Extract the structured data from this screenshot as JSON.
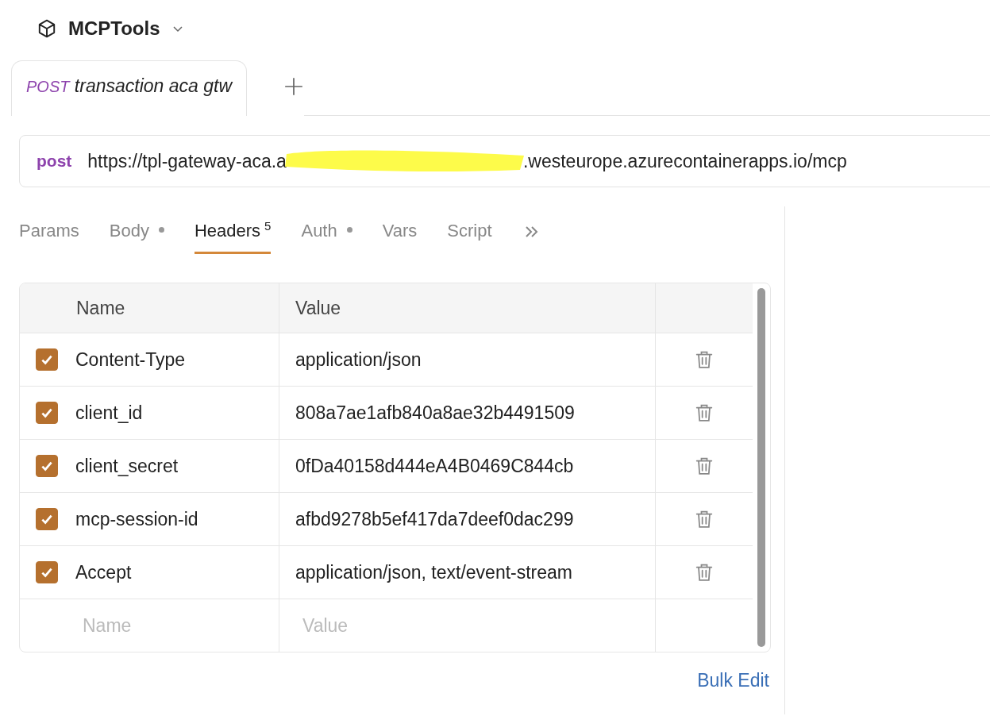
{
  "collection": {
    "name": "MCPTools"
  },
  "request_tabs": [
    {
      "method": "POST",
      "name": "transaction aca gtw",
      "selected": true
    }
  ],
  "url_bar": {
    "method": "post",
    "url_start": "https://tpl-gateway-aca.a",
    "url_end": ".westeurope.azurecontainerapps.io/mcp"
  },
  "section_tabs": [
    {
      "label": "Params",
      "selected": false,
      "indicator": false
    },
    {
      "label": "Body",
      "selected": false,
      "indicator": true
    },
    {
      "label": "Headers",
      "selected": true,
      "indicator": false,
      "count": "5"
    },
    {
      "label": "Auth",
      "selected": false,
      "indicator": true
    },
    {
      "label": "Vars",
      "selected": false,
      "indicator": false
    },
    {
      "label": "Script",
      "selected": false,
      "indicator": false
    }
  ],
  "headers_table": {
    "columns": [
      "Name",
      "Value"
    ],
    "rows": [
      {
        "checked": true,
        "name": "Content-Type",
        "value": "application/json"
      },
      {
        "checked": true,
        "name": "client_id",
        "value": "808a7ae1afb840a8ae32b4491509"
      },
      {
        "checked": true,
        "name": "client_secret",
        "value": "0fDa40158d444eA4B0469C844cb"
      },
      {
        "checked": true,
        "name": "mcp-session-id",
        "value": "afbd9278b5ef417da7deef0dac299"
      },
      {
        "checked": true,
        "name": "Accept",
        "value": "application/json, text/event-stream"
      }
    ],
    "new_row": {
      "name_placeholder": "Name",
      "value_placeholder": "Value"
    }
  },
  "bulk_edit": "Bulk Edit"
}
